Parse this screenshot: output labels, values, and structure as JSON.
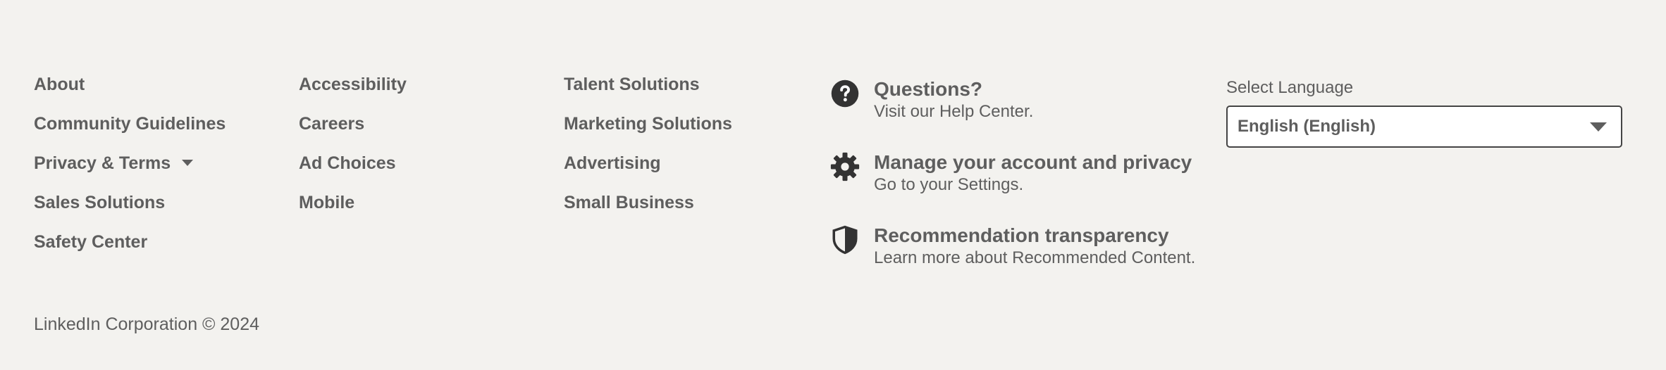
{
  "links": {
    "col1": [
      {
        "label": "About"
      },
      {
        "label": "Community Guidelines"
      },
      {
        "label": "Privacy & Terms",
        "has_dropdown": true
      },
      {
        "label": "Sales Solutions"
      },
      {
        "label": "Safety Center"
      }
    ],
    "col2": [
      {
        "label": "Accessibility"
      },
      {
        "label": "Careers"
      },
      {
        "label": "Ad Choices"
      },
      {
        "label": "Mobile"
      }
    ],
    "col3": [
      {
        "label": "Talent Solutions"
      },
      {
        "label": "Marketing Solutions"
      },
      {
        "label": "Advertising"
      },
      {
        "label": "Small Business"
      }
    ]
  },
  "help": [
    {
      "icon": "question-circle-icon",
      "title": "Questions?",
      "desc_prefix": "Visit our ",
      "desc_link": "Help Center",
      "desc_suffix": "."
    },
    {
      "icon": "gear-icon",
      "title": "Manage your account and privacy",
      "desc_prefix": "Go to your ",
      "desc_link": "Settings",
      "desc_suffix": "."
    },
    {
      "icon": "shield-icon",
      "title": "Recommendation transparency",
      "desc_prefix": "Learn more about ",
      "desc_link": "Recommended Content",
      "desc_suffix": "."
    }
  ],
  "language": {
    "label": "Select Language",
    "selected": "English (English)"
  },
  "copyright": "LinkedIn Corporation © 2024",
  "colors": {
    "background": "#f3f2ef",
    "text": "#5e5e5e",
    "icon": "#333333"
  }
}
